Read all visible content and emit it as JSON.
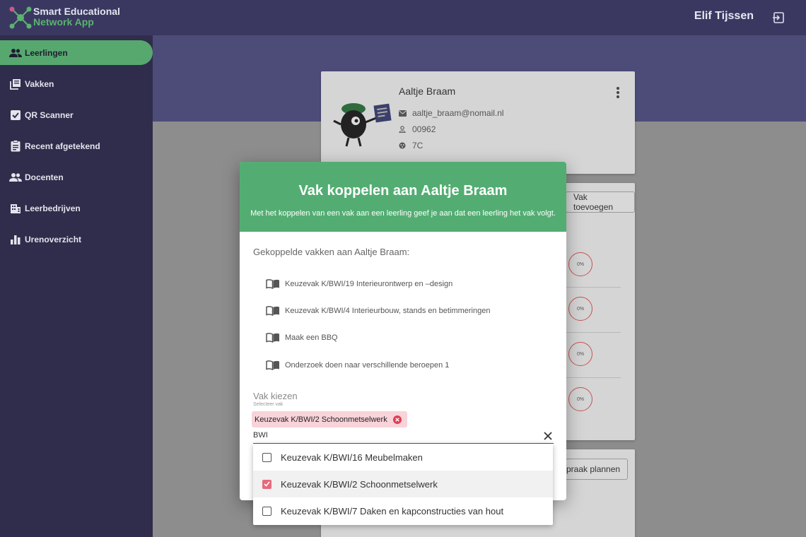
{
  "app": {
    "logo_line1": "Smart Educational",
    "logo_line2": "Network App",
    "user_name": "Elif Tijssen"
  },
  "sidebar": {
    "items": [
      {
        "label": "Leerlingen",
        "icon": "people-icon",
        "active": true
      },
      {
        "label": "Vakken",
        "icon": "library-books-icon",
        "active": false
      },
      {
        "label": "QR Scanner",
        "icon": "checkbox-icon",
        "active": false
      },
      {
        "label": "Recent afgetekend",
        "icon": "clipboard-icon",
        "active": false
      },
      {
        "label": "Docenten",
        "icon": "people-icon",
        "active": false
      },
      {
        "label": "Leerbedrijven",
        "icon": "building-icon",
        "active": false
      },
      {
        "label": "Urenoverzicht",
        "icon": "bar-chart-icon",
        "active": false
      }
    ]
  },
  "profile": {
    "name": "Aaltje Braam",
    "email": "aaltje_braam@nomail.nl",
    "number": "00962",
    "class": "7C"
  },
  "subjects_card": {
    "add_button": "Vak toevoegen",
    "progress": [
      "0%",
      "0%",
      "0%",
      "0%"
    ]
  },
  "bottom_card": {
    "button": "praak plannen"
  },
  "modal": {
    "title": "Vak koppelen aan Aaltje Braam",
    "subtitle": "Met het koppelen van een vak aan een leerling geef je aan dat een leerling het vak volgt.",
    "linked_label": "Gekoppelde vakken aan Aaltje Braam:",
    "linked": [
      "Keuzevak K/BWI/19 Interieurontwerp en –design",
      "Keuzevak K/BWI/4 Interieurbouw, stands en betimmeringen",
      "Maak een BBQ",
      "Onderzoek doen naar verschillende beroepen 1"
    ],
    "select_label": "Vak kiezen",
    "select_hint": "Selecteer vak",
    "chip": "Keuzevak K/BWI/2 Schoonmetselwerk",
    "search_value": "BWI"
  },
  "dropdown": {
    "options": [
      {
        "label": "Keuzevak K/BWI/16 Meubelmaken",
        "checked": false
      },
      {
        "label": "Keuzevak K/BWI/2 Schoonmetselwerk",
        "checked": true
      },
      {
        "label": "Keuzevak K/BWI/7 Daken en kapconstructies van hout",
        "checked": false
      }
    ]
  },
  "colors": {
    "accent_green": "#53ad72",
    "sidebar": "#2f2d4b",
    "chip_bg": "#f8d3d9",
    "checkbox_checked": "#e46a7c",
    "progress_ring": "#c95252"
  }
}
